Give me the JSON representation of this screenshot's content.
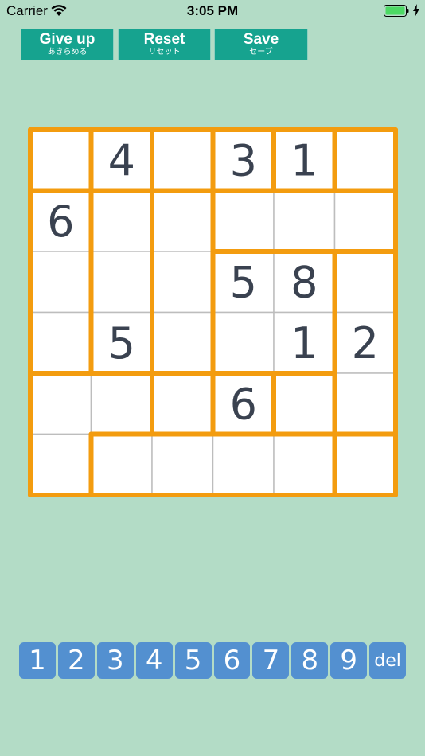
{
  "status_bar": {
    "carrier": "Carrier",
    "time": "3:05 PM"
  },
  "toolbar": [
    {
      "id": "giveup",
      "label": "Give up",
      "sub": "あきらめる"
    },
    {
      "id": "reset",
      "label": "Reset",
      "sub": "リセット"
    },
    {
      "id": "save",
      "label": "Save",
      "sub": "セーブ"
    }
  ],
  "board": {
    "size": 6,
    "cells": [
      [
        "",
        "4",
        "",
        "3",
        "1",
        ""
      ],
      [
        "6",
        "",
        "",
        "",
        "",
        ""
      ],
      [
        "",
        "",
        "",
        "5",
        "8",
        ""
      ],
      [
        "",
        "5",
        "",
        "",
        "1",
        "2"
      ],
      [
        "",
        "",
        "",
        "6",
        "",
        ""
      ],
      [
        "",
        "",
        "",
        "",
        "",
        ""
      ]
    ],
    "regions": [
      [
        "A",
        "B",
        "C",
        "D",
        "E",
        "F"
      ],
      [
        "G",
        "H",
        "I",
        "J",
        "J",
        "J"
      ],
      [
        "G",
        "H",
        "I",
        "K",
        "K",
        "L"
      ],
      [
        "G",
        "H",
        "I",
        "K",
        "K",
        "L"
      ],
      [
        "M",
        "M",
        "N",
        "O",
        "P",
        "L"
      ],
      [
        "M",
        "Q",
        "Q",
        "Q",
        "Q",
        "R"
      ]
    ],
    "colors": {
      "cell": "#ffffff",
      "grid": "#bdbdbd",
      "region_border": "#f39c0f",
      "digit": "#3a4250"
    }
  },
  "number_pad": [
    "1",
    "2",
    "3",
    "4",
    "5",
    "6",
    "7",
    "8",
    "9",
    "del"
  ],
  "colors": {
    "background": "#b3dcc6",
    "toolbar_button": "#16a38f",
    "pad_key": "#5390d0"
  }
}
